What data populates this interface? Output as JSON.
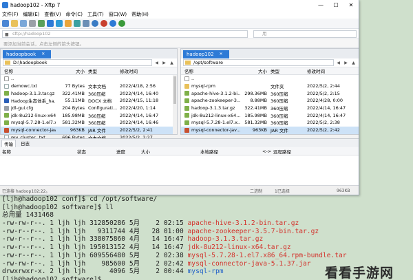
{
  "window": {
    "title": "hadoop102 - Xftp 7",
    "min_glyph": "—",
    "max_glyph": "☐",
    "close_glyph": "✕"
  },
  "menu": [
    "文件(F)",
    "编辑(E)",
    "查看(V)",
    "命令(C)",
    "工具(T)",
    "窗口(W)",
    "帮助(H)"
  ],
  "address": {
    "host": "sftp://hadoop102",
    "password_placeholder": "用",
    "hint": "要添加当前会话，点击左侧的箭头按钮。"
  },
  "left_pane": {
    "tab": "hadoopbook",
    "path": "D:\\hadoopbook",
    "columns": [
      "名称",
      "大小",
      "类型",
      "修改时间"
    ],
    "rows": [
      {
        "name": "..",
        "size": "",
        "type": "",
        "date": "",
        "icon": "up-icon"
      },
      {
        "name": "demowc.txt",
        "size": "77 Bytes",
        "type": "文本文档",
        "date": "2022/4/18, 2:56",
        "icon": "text-file-icon"
      },
      {
        "name": "hadoop-3.1.3.tar.gz",
        "size": "322.41MB",
        "type": "360压缩",
        "date": "2022/4/14, 16:40",
        "icon": "archive-icon"
      },
      {
        "name": "Hadoop生态体系_ha...",
        "size": "55.11MB",
        "type": "DOCX 文档",
        "date": "2022/4/15, 11:18",
        "icon": "word-doc-icon"
      },
      {
        "name": "jdl-gui.cfg",
        "size": "204 Bytes",
        "type": "Configurati...",
        "date": "2022/4/20, 1:14",
        "icon": "config-file-icon"
      },
      {
        "name": "jdk-8u212-linux-x64...",
        "size": "185.98MB",
        "type": "360压缩",
        "date": "2022/4/14, 16:47",
        "icon": "archive-icon"
      },
      {
        "name": "mysql-5.7.28-1.el7.x...",
        "size": "581.32MB",
        "type": "360压缩",
        "date": "2022/4/14, 16:46",
        "icon": "archive-icon"
      },
      {
        "name": "mysql-connector-jav...",
        "size": "963KB",
        "type": "JAR 文件",
        "date": "2022/5/2, 2:41",
        "icon": "jar-icon",
        "selected": true
      },
      {
        "name": "my_cluster_.txt",
        "size": "696 Bytes",
        "type": "文本文档",
        "date": "2022/5/2, 2:27",
        "icon": "text-file-icon"
      }
    ]
  },
  "right_pane": {
    "tab": "hadoop102",
    "path": "/opt/software",
    "columns": [
      "名称",
      "大小",
      "类型",
      "修改时间"
    ],
    "rows": [
      {
        "name": "..",
        "size": "",
        "type": "",
        "date": "",
        "icon": "up-icon"
      },
      {
        "name": "mysql-rpm",
        "size": "",
        "type": "文件夹",
        "date": "2022/5/2, 2:44",
        "icon": "folder-icon"
      },
      {
        "name": "apache-hive-3.1.2-bi...",
        "size": "298.36MB",
        "type": "360压缩",
        "date": "2022/5/2, 2:15",
        "icon": "archive-icon"
      },
      {
        "name": "apache-zookeeper-3...",
        "size": "8.88MB",
        "type": "360压缩",
        "date": "2022/4/28, 0:00",
        "icon": "archive-icon"
      },
      {
        "name": "hadoop-3.1.3.tar.gz",
        "size": "322.41MB",
        "type": "360压缩",
        "date": "2022/4/14, 16:47",
        "icon": "archive-icon"
      },
      {
        "name": "jdk-8u212-linux-x64...",
        "size": "185.98MB",
        "type": "360压缩",
        "date": "2022/4/14, 16:47",
        "icon": "archive-icon"
      },
      {
        "name": "mysql-5.7.28-1.el7.x...",
        "size": "581.32MB",
        "type": "360压缩",
        "date": "2022/5/2, 2:38",
        "icon": "archive-icon"
      },
      {
        "name": "mysql-connector-jav...",
        "size": "963KB",
        "type": "JAR 文件",
        "date": "2022/5/2, 2:42",
        "icon": "jar-icon",
        "selected": true
      }
    ]
  },
  "transfer": {
    "tabs": [
      "传输",
      "日志"
    ],
    "columns": [
      "名称",
      "状态",
      "进度",
      "大小",
      "本地路径",
      "<->",
      "远程路径"
    ]
  },
  "status": {
    "left": "已连接 hadoop102:22。",
    "mid1": "二进制",
    "mid2": "1已选择",
    "right": "963KB"
  },
  "terminal": [
    {
      "prompt": "[ljh@hadoop102 conf]$ cd /opt/software/"
    },
    {
      "prompt": "[ljh@hadoop102 software]$ ll"
    },
    {
      "prompt": "总用量 1431468"
    },
    {
      "meta": "-rw-rw-r--. 1 ljh ljh 312850286 5月    2 02:15 ",
      "file": "apache-hive-3.1.2-bin.tar.gz",
      "color": "red"
    },
    {
      "meta": "-rw-r--r--. 1 ljh ljh   9311744 4月   28 01:00 ",
      "file": "apache-zookeeper-3.5.7-bin.tar.gz",
      "color": "red"
    },
    {
      "meta": "-rw-r--r--. 1 ljh ljh 338075860 4月   14 16:47 ",
      "file": "hadoop-3.1.3.tar.gz",
      "color": "red"
    },
    {
      "meta": "-rw-r--r--. 1 ljh ljh 195013152 4月   14 16:47 ",
      "file": "jdk-8u212-linux-x64.tar.gz",
      "color": "red"
    },
    {
      "meta": "-rw-r--r--. 1 ljh ljh 609556480 5月    2 02:38 ",
      "file": "mysql-5.7.28-1.el7.x86_64.rpm-bundle.tar",
      "color": "red"
    },
    {
      "meta": "-rw-rw-r--. 1 ljh ljh    985600 5月    2 02:42 ",
      "file": "mysql-connector-java-5.1.37.jar",
      "color": "red"
    },
    {
      "meta": "drwxrwxr-x. 2 ljh ljh      4096 5月    2 00:44 ",
      "file": "mysql-rpm",
      "color": "blue"
    },
    {
      "prompt": "[ljh@hadoop102 software]$ "
    }
  ],
  "watermark": "看看手游网"
}
